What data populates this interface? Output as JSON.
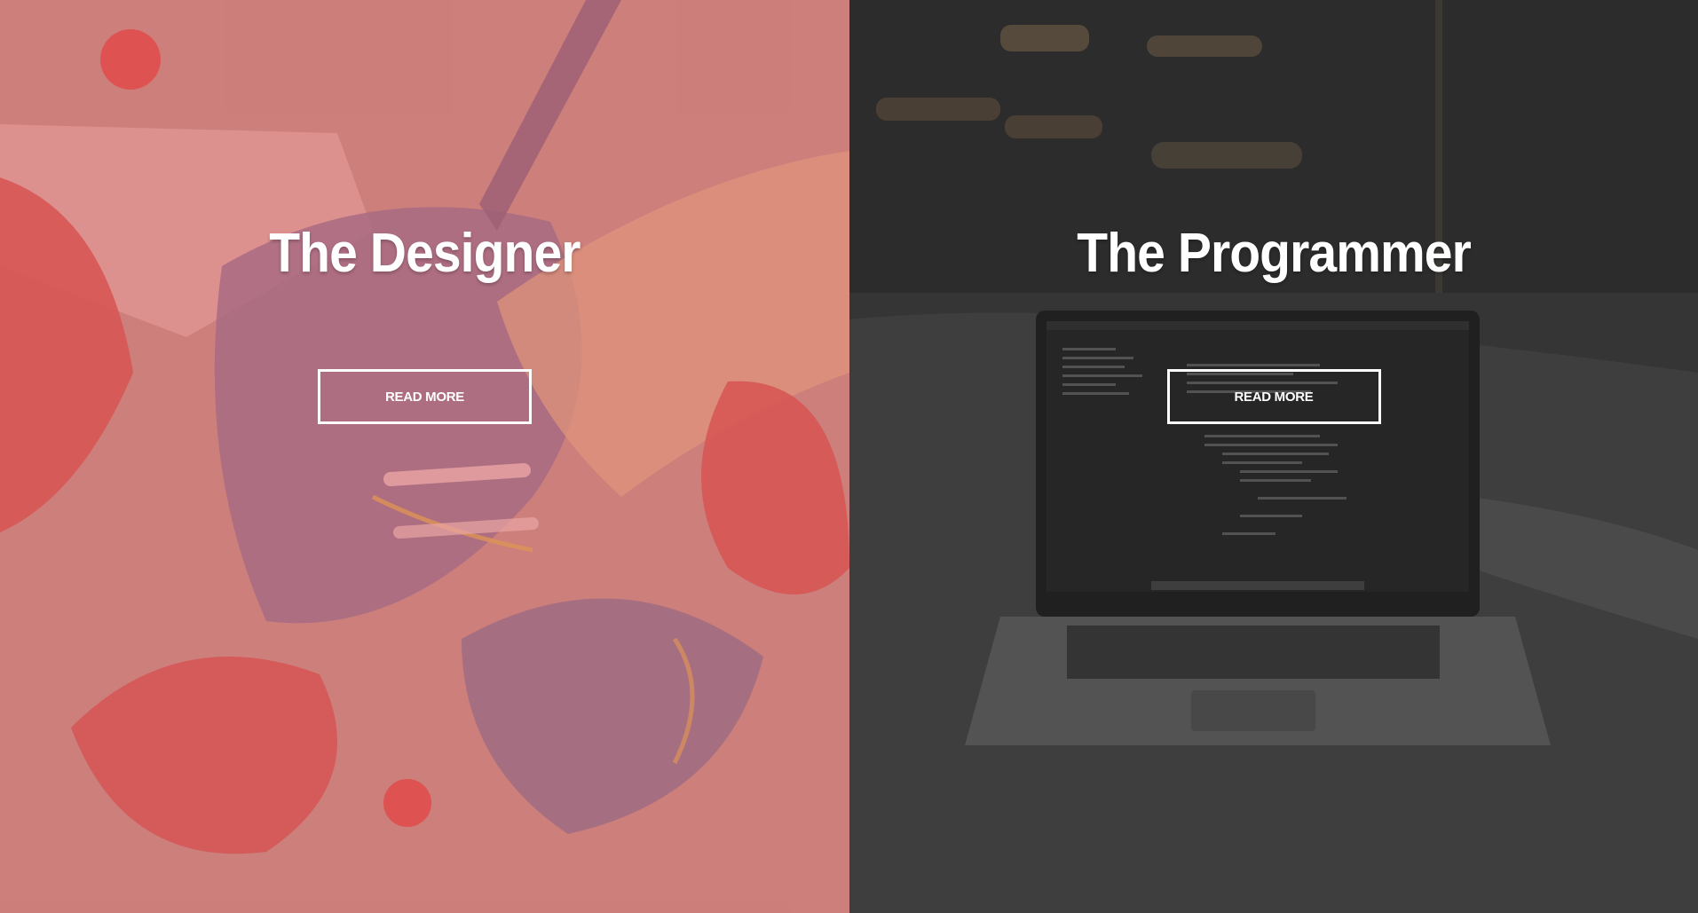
{
  "left": {
    "title": "The Designer",
    "button_label": "READ MORE"
  },
  "right": {
    "title": "The Programmer",
    "button_label": "READ MORE"
  },
  "colors": {
    "designer_tint": "#c97a78",
    "programmer_tint": "#3a3a3a",
    "text": "#ffffff"
  }
}
